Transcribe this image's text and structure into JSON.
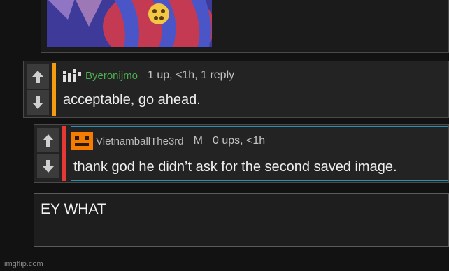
{
  "image_card": {
    "icon": "embedded-image",
    "colors": {
      "sky": "#3e3a9a",
      "stripe_red": "#c43a52",
      "stripe_blue": "#4a55c8",
      "yellow": "#f2c744"
    }
  },
  "comments": [
    {
      "username": "Byeronijmo",
      "username_color": "#4caf50",
      "stats": "1 up, <1h, 1 reply",
      "text": "acceptable, go ahead.",
      "accent": "#f39c12"
    },
    {
      "username": "VietnamballThe3rd",
      "username_color": "#bdbdbd",
      "badge": "M",
      "stats": "0 ups, <1h",
      "text": "thank god he didn’t ask for the second saved image.",
      "accent": "#e53935"
    }
  ],
  "reply": {
    "text": "EY WHAT"
  },
  "watermark": "imgflip.com"
}
